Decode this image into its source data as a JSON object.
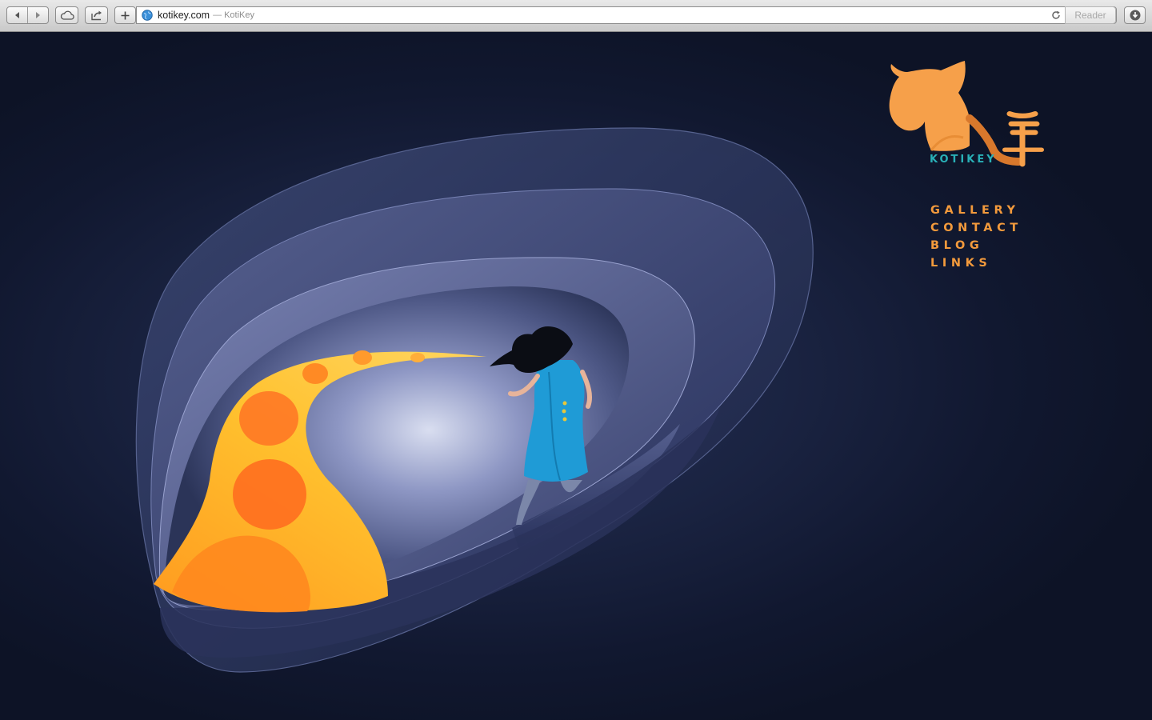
{
  "browser": {
    "url": "kotikey.com",
    "separator": "—",
    "page_title": "KotiKey",
    "reader_label": "Reader",
    "icons": {
      "back": "back-arrow-icon",
      "forward": "forward-arrow-icon",
      "icloud": "cloud-icon",
      "share": "share-icon",
      "new_tab": "plus-icon",
      "site": "globe-icon",
      "reload": "reload-icon",
      "downloads": "download-icon"
    }
  },
  "site": {
    "logo_text": "KOTIKEY",
    "nav": [
      {
        "label": "GALLERY"
      },
      {
        "label": "CONTACT"
      },
      {
        "label": "BLOG"
      },
      {
        "label": "LINKS"
      }
    ]
  },
  "colors": {
    "background": "#101628",
    "nav_accent": "#f39a3c",
    "logo_cat": "#f6a04a",
    "logo_text": "#29b0b7",
    "path_yellow": "#ffc12e",
    "dress_blue": "#1f9bd6"
  }
}
